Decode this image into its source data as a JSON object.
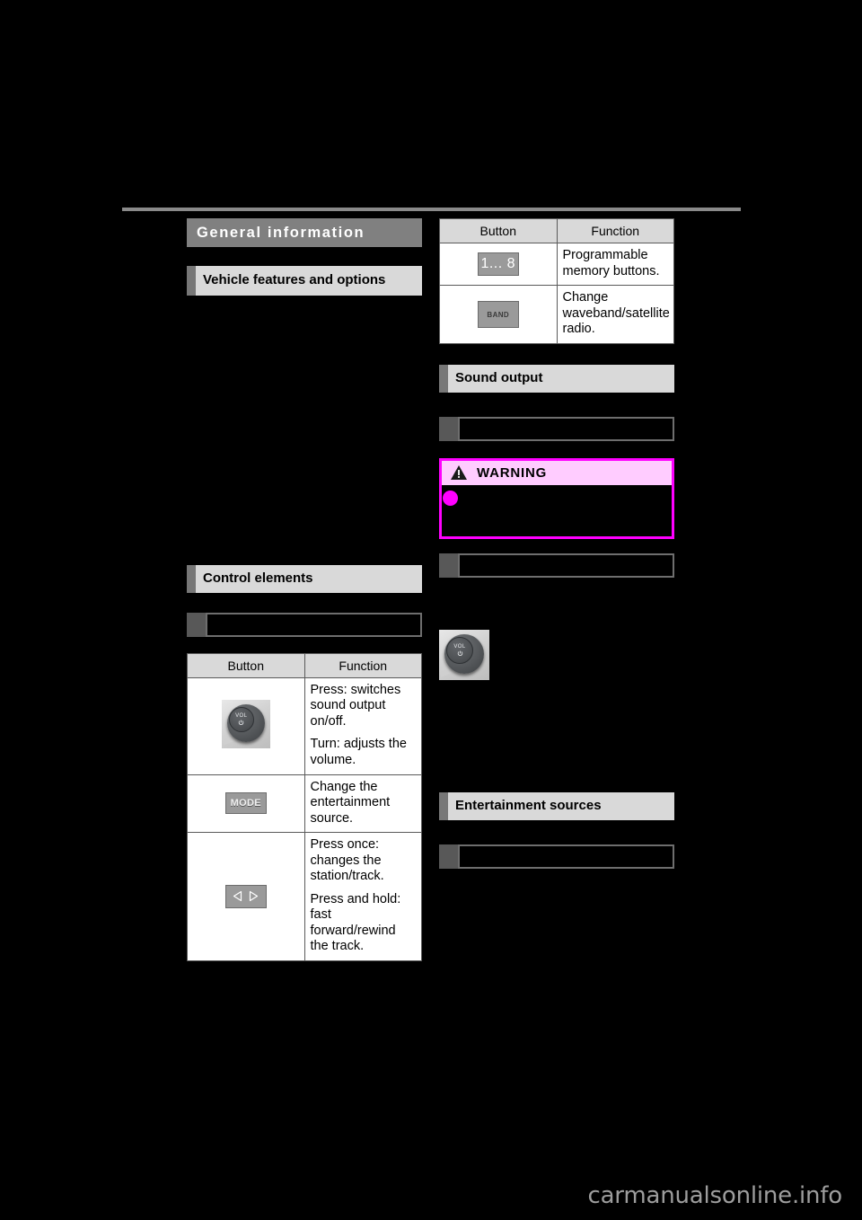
{
  "document": {
    "watermark": "carmanualsonline.info"
  },
  "left_column": {
    "chapter_title": "General information",
    "section_heading": "Vehicle features and options",
    "subsection_heading": "Control elements",
    "table": {
      "headers": [
        "Button",
        "Function"
      ],
      "rows": [
        {
          "button_icon": "volume-knob-photo",
          "button_label": "VOL",
          "functions": [
            "Press: switches sound output on/off.",
            "Turn: adjusts the volume."
          ]
        },
        {
          "button_icon": "mode-button",
          "button_label": "MODE",
          "functions": [
            "Change the entertainment source."
          ]
        },
        {
          "button_icon": "seek-button",
          "button_label": "◁ ▷",
          "functions": [
            "Press once: changes the station/track.",
            "Press and hold: fast forward/rewind the track."
          ]
        }
      ]
    }
  },
  "right_column": {
    "table": {
      "headers": [
        "Button",
        "Function"
      ],
      "rows": [
        {
          "button_icon": "memory-buttons",
          "button_label": "1... 8",
          "functions": [
            "Programmable memory buttons."
          ]
        },
        {
          "button_icon": "band-button",
          "button_label": "BAND",
          "functions": [
            "Change waveband/satellite radio."
          ]
        }
      ]
    },
    "section_heading_sound": "Sound output",
    "warning": {
      "icon": "warning-triangle-icon",
      "title": "WARNING"
    },
    "section_heading_sources": "Entertainment sources",
    "knob_icon": "volume-knob-photo",
    "knob_label": "VOL"
  },
  "colors": {
    "chapter_bar": "#808080",
    "section_box": "#d9d9d9",
    "section_tab": "#777777",
    "sub_tab": "#585858",
    "sub_outline": "#6e6e6e",
    "warning_border": "#ff00ff",
    "warning_header": "#ffccff",
    "table_border": "#5a5a5a",
    "table_header_bg": "#d9d9d9",
    "page_bg": "#000000",
    "rule": "#8a8a8a"
  }
}
